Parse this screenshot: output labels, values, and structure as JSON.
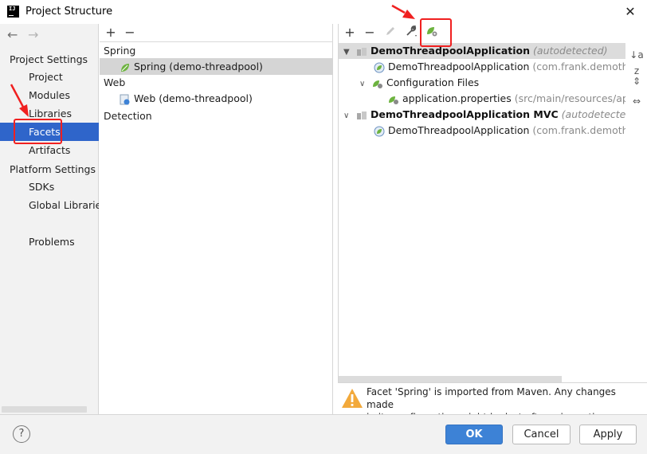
{
  "window": {
    "title": "Project Structure",
    "close_glyph": "✕"
  },
  "nav": {
    "back": "←",
    "forward": "→",
    "project_settings_header": "Project Settings",
    "project_settings": [
      {
        "label": "Project",
        "selected": false
      },
      {
        "label": "Modules",
        "selected": false
      },
      {
        "label": "Libraries",
        "selected": false
      },
      {
        "label": "Facets",
        "selected": true
      },
      {
        "label": "Artifacts",
        "selected": false
      }
    ],
    "platform_settings_header": "Platform Settings",
    "platform_settings": [
      {
        "label": "SDKs"
      },
      {
        "label": "Global Libraries"
      }
    ],
    "problems": "Problems"
  },
  "facets": {
    "toolbar": {
      "add": "+",
      "remove": "−"
    },
    "groups": [
      {
        "name": "Spring",
        "items": [
          {
            "label": "Spring (demo-threadpool)",
            "icon": "spring-leaf-icon",
            "selected": true
          }
        ]
      },
      {
        "name": "Web",
        "items": [
          {
            "label": "Web (demo-threadpool)",
            "icon": "web-facet-icon",
            "selected": false
          }
        ]
      },
      {
        "name": "Detection",
        "items": []
      }
    ]
  },
  "tree": {
    "toolbar": {
      "add": "+",
      "remove": "−",
      "edit": "pencil-icon",
      "settings": "wrench-icon",
      "spring_config": "spring-config-icon"
    },
    "rows": [
      {
        "level": 0,
        "expanded": true,
        "bold": "DemoThreadpoolApplication",
        "grey": "(autodetected)",
        "italic": true,
        "header": true
      },
      {
        "level": 1,
        "label": "DemoThreadpoolApplication",
        "grey": "(com.frank.demothrea"
      },
      {
        "level": 1,
        "expanded": true,
        "label": "Configuration Files"
      },
      {
        "level": 2,
        "label": "application.properties",
        "grey": "(src/main/resources/appli"
      },
      {
        "level": 0,
        "expanded": true,
        "bold": "DemoThreadpoolApplication MVC",
        "grey": "(autodetected)",
        "italic": true,
        "header": false
      },
      {
        "level": 1,
        "label": "DemoThreadpoolApplication",
        "grey": "(com.frank.demothrea"
      }
    ],
    "side_toolbar": {
      "sort": "↓a z",
      "expand": "⇕",
      "collapse": "⇔"
    }
  },
  "warning": {
    "line1": "Facet 'Spring' is imported from Maven. Any changes made",
    "line2": "in its configuration might be lost after reimporting."
  },
  "buttons": {
    "help": "?",
    "ok": "OK",
    "cancel": "Cancel",
    "apply": "Apply"
  },
  "colors": {
    "selection": "#2f65ca",
    "spring": "#6db33f",
    "annotation": "#f02020",
    "ok": "#3d82d6"
  }
}
